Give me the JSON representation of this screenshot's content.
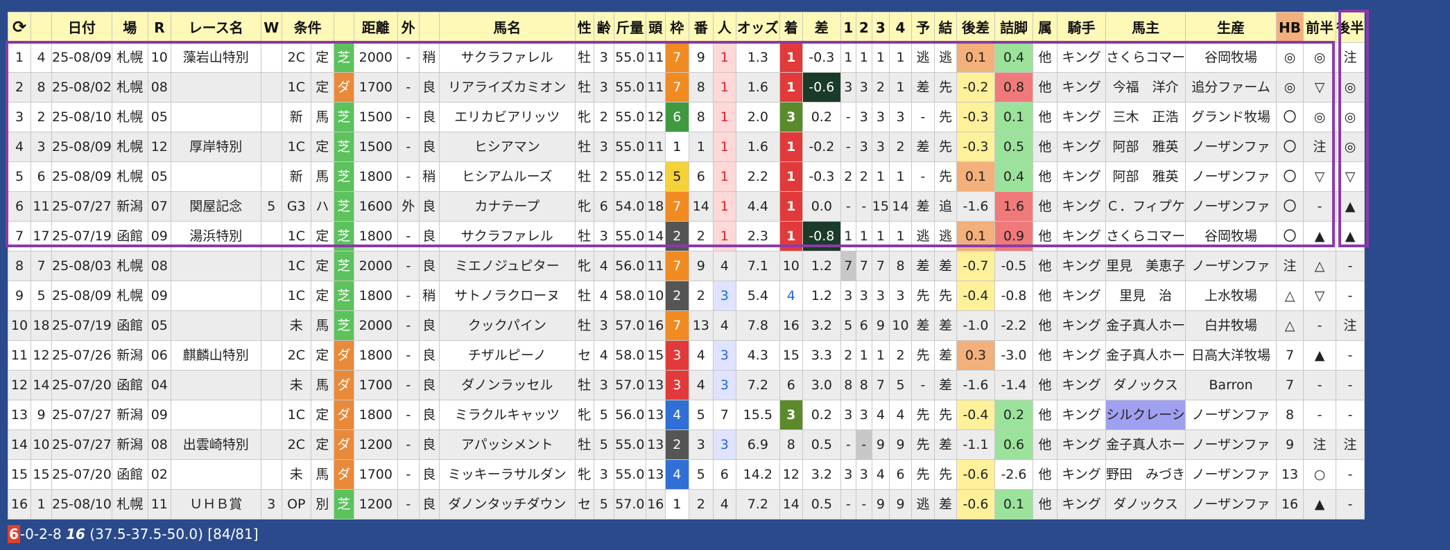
{
  "header": {
    "refresh_icon": "refresh-icon",
    "columns": [
      "日付",
      "場",
      "R",
      "レース名",
      "W",
      "条件",
      "",
      "距離",
      "外",
      "",
      "馬名",
      "性",
      "齢",
      "斤量",
      "頭",
      "枠",
      "番",
      "人",
      "オッズ",
      "着",
      "差",
      "1",
      "2",
      "3",
      "4",
      "予",
      "結",
      "後差",
      "詰脚",
      "属",
      "騎手",
      "馬主",
      "生産",
      "HB",
      "前半",
      "後半"
    ]
  },
  "rows": [
    {
      "no": "1",
      "a": "4",
      "date": "25-08/09",
      "place": "札幌",
      "r": "10",
      "race": "藻岩山特別",
      "w": "",
      "cls": "2C",
      "cond": "定",
      "surf": "芝",
      "dist": "2000",
      "out": "-",
      "track": "稍",
      "horse": "サクラファレル",
      "sex": "牡",
      "age": "3",
      "kin": "55.0",
      "heads": "11",
      "waku": "7",
      "ban": "9",
      "pop": "1",
      "odds": "1.3",
      "fin": "1",
      "diff": "-0.3",
      "c1": "1",
      "c2": "1",
      "c3": "1",
      "c4": "1",
      "pred": "逃",
      "res": "逃",
      "atosa": "0.1",
      "tsume": "0.4",
      "zoku": "他",
      "jockey": "キング",
      "owner": "さくらコマー",
      "breeder": "谷岡牧場",
      "hb": "◎",
      "zen": "◎",
      "kou": "注"
    },
    {
      "no": "2",
      "a": "8",
      "date": "25-08/02",
      "place": "札幌",
      "r": "08",
      "race": "",
      "w": "",
      "cls": "1C",
      "cond": "定",
      "surf": "ダ",
      "dist": "1700",
      "out": "-",
      "track": "良",
      "horse": "リアライズカミオン",
      "sex": "牡",
      "age": "3",
      "kin": "55.0",
      "heads": "11",
      "waku": "7",
      "ban": "8",
      "pop": "1",
      "odds": "1.6",
      "fin": "1",
      "diff": "-0.6",
      "c1": "3",
      "c2": "3",
      "c3": "2",
      "c4": "1",
      "pred": "差",
      "res": "先",
      "atosa": "-0.2",
      "tsume": "0.8",
      "zoku": "他",
      "jockey": "キング",
      "owner": "今福　洋介",
      "breeder": "追分ファーム",
      "hb": "◎",
      "zen": "▽",
      "kou": "◎"
    },
    {
      "no": "3",
      "a": "2",
      "date": "25-08/10",
      "place": "札幌",
      "r": "05",
      "race": "",
      "w": "",
      "cls": "新",
      "cond": "馬",
      "surf": "芝",
      "dist": "1500",
      "out": "-",
      "track": "良",
      "horse": "エリカビアリッツ",
      "sex": "牝",
      "age": "2",
      "kin": "55.0",
      "heads": "12",
      "waku": "6",
      "ban": "8",
      "pop": "1",
      "odds": "2.0",
      "fin": "3",
      "diff": "0.2",
      "c1": "-",
      "c2": "3",
      "c3": "3",
      "c4": "3",
      "pred": "-",
      "res": "先",
      "atosa": "-0.3",
      "tsume": "0.1",
      "zoku": "他",
      "jockey": "キング",
      "owner": "三木　正浩",
      "breeder": "グランド牧場",
      "hb": "〇",
      "zen": "◎",
      "kou": "◎"
    },
    {
      "no": "4",
      "a": "3",
      "date": "25-08/09",
      "place": "札幌",
      "r": "12",
      "race": "厚岸特別",
      "w": "",
      "cls": "1C",
      "cond": "定",
      "surf": "芝",
      "dist": "1500",
      "out": "-",
      "track": "良",
      "horse": "ヒシアマン",
      "sex": "牡",
      "age": "3",
      "kin": "55.0",
      "heads": "11",
      "waku": "1",
      "ban": "1",
      "pop": "1",
      "odds": "1.6",
      "fin": "1",
      "diff": "-0.2",
      "c1": "-",
      "c2": "3",
      "c3": "3",
      "c4": "2",
      "pred": "差",
      "res": "先",
      "atosa": "-0.3",
      "tsume": "0.5",
      "zoku": "他",
      "jockey": "キング",
      "owner": "阿部　雅英",
      "breeder": "ノーザンファ",
      "hb": "〇",
      "zen": "注",
      "kou": "◎"
    },
    {
      "no": "5",
      "a": "6",
      "date": "25-08/09",
      "place": "札幌",
      "r": "05",
      "race": "",
      "w": "",
      "cls": "新",
      "cond": "馬",
      "surf": "芝",
      "dist": "1800",
      "out": "-",
      "track": "稍",
      "horse": "ヒシアムルーズ",
      "sex": "牡",
      "age": "2",
      "kin": "55.0",
      "heads": "12",
      "waku": "5",
      "ban": "6",
      "pop": "1",
      "odds": "2.2",
      "fin": "1",
      "diff": "-0.3",
      "c1": "2",
      "c2": "2",
      "c3": "1",
      "c4": "1",
      "pred": "-",
      "res": "先",
      "atosa": "0.1",
      "tsume": "0.4",
      "zoku": "他",
      "jockey": "キング",
      "owner": "阿部　雅英",
      "breeder": "ノーザンファ",
      "hb": "〇",
      "zen": "▽",
      "kou": "▽"
    },
    {
      "no": "6",
      "a": "11",
      "date": "25-07/27",
      "place": "新潟",
      "r": "07",
      "race": "関屋記念",
      "w": "5",
      "cls": "G3",
      "cond": "ハ",
      "surf": "芝",
      "dist": "1600",
      "out": "外",
      "track": "良",
      "horse": "カナテープ",
      "sex": "牝",
      "age": "6",
      "kin": "54.0",
      "heads": "18",
      "waku": "7",
      "ban": "14",
      "pop": "1",
      "odds": "4.4",
      "fin": "1",
      "diff": "0.0",
      "c1": "-",
      "c2": "-",
      "c3": "15",
      "c4": "14",
      "pred": "差",
      "res": "追",
      "atosa": "-1.6",
      "tsume": "1.6",
      "zoku": "他",
      "jockey": "キング",
      "owner": "Ｃ．フィプケ",
      "breeder": "ノーザンファ",
      "hb": "〇",
      "zen": "-",
      "kou": "▲"
    },
    {
      "no": "7",
      "a": "17",
      "date": "25-07/19",
      "place": "函館",
      "r": "09",
      "race": "湯浜特別",
      "w": "",
      "cls": "1C",
      "cond": "定",
      "surf": "芝",
      "dist": "1800",
      "out": "-",
      "track": "良",
      "horse": "サクラファレル",
      "sex": "牡",
      "age": "3",
      "kin": "55.0",
      "heads": "14",
      "waku": "2",
      "ban": "2",
      "pop": "1",
      "odds": "2.3",
      "fin": "1",
      "diff": "-0.8",
      "c1": "1",
      "c2": "1",
      "c3": "1",
      "c4": "1",
      "pred": "逃",
      "res": "逃",
      "atosa": "0.1",
      "tsume": "0.9",
      "zoku": "他",
      "jockey": "キング",
      "owner": "さくらコマー",
      "breeder": "谷岡牧場",
      "hb": "〇",
      "zen": "▲",
      "kou": "▲"
    },
    {
      "no": "8",
      "a": "7",
      "date": "25-08/03",
      "place": "札幌",
      "r": "08",
      "race": "",
      "w": "",
      "cls": "1C",
      "cond": "定",
      "surf": "芝",
      "dist": "2000",
      "out": "-",
      "track": "良",
      "horse": "ミエノジュピター",
      "sex": "牝",
      "age": "4",
      "kin": "56.0",
      "heads": "11",
      "waku": "7",
      "ban": "9",
      "pop": "4",
      "odds": "7.1",
      "fin": "10",
      "diff": "1.2",
      "c1": "7",
      "c2": "7",
      "c3": "7",
      "c4": "8",
      "pred": "差",
      "res": "差",
      "atosa": "-0.7",
      "tsume": "-0.5",
      "zoku": "他",
      "jockey": "キング",
      "owner": "里見　美恵子",
      "breeder": "ノーザンファ",
      "hb": "注",
      "zen": "△",
      "kou": "-"
    },
    {
      "no": "9",
      "a": "5",
      "date": "25-08/09",
      "place": "札幌",
      "r": "09",
      "race": "",
      "w": "",
      "cls": "1C",
      "cond": "定",
      "surf": "芝",
      "dist": "1800",
      "out": "-",
      "track": "稍",
      "horse": "サトノラクローヌ",
      "sex": "牡",
      "age": "4",
      "kin": "58.0",
      "heads": "10",
      "waku": "2",
      "ban": "2",
      "pop": "3",
      "odds": "5.4",
      "fin": "4",
      "diff": "1.2",
      "c1": "3",
      "c2": "3",
      "c3": "3",
      "c4": "3",
      "pred": "先",
      "res": "先",
      "atosa": "-0.4",
      "tsume": "-0.8",
      "zoku": "他",
      "jockey": "キング",
      "owner": "里見　治",
      "breeder": "上水牧場",
      "hb": "△",
      "zen": "▽",
      "kou": "-"
    },
    {
      "no": "10",
      "a": "18",
      "date": "25-07/19",
      "place": "函館",
      "r": "05",
      "race": "",
      "w": "",
      "cls": "未",
      "cond": "馬",
      "surf": "芝",
      "dist": "2000",
      "out": "-",
      "track": "良",
      "horse": "クックパイン",
      "sex": "牡",
      "age": "3",
      "kin": "57.0",
      "heads": "16",
      "waku": "7",
      "ban": "13",
      "pop": "4",
      "odds": "7.8",
      "fin": "16",
      "diff": "3.2",
      "c1": "5",
      "c2": "6",
      "c3": "9",
      "c4": "10",
      "pred": "差",
      "res": "差",
      "atosa": "-1.0",
      "tsume": "-2.2",
      "zoku": "他",
      "jockey": "キング",
      "owner": "金子真人ホー",
      "breeder": "白井牧場",
      "hb": "△",
      "zen": "-",
      "kou": "注"
    },
    {
      "no": "11",
      "a": "12",
      "date": "25-07/26",
      "place": "新潟",
      "r": "06",
      "race": "麒麟山特別",
      "w": "",
      "cls": "2C",
      "cond": "定",
      "surf": "ダ",
      "dist": "1800",
      "out": "-",
      "track": "良",
      "horse": "チザルピーノ",
      "sex": "セ",
      "age": "4",
      "kin": "58.0",
      "heads": "15",
      "waku": "3",
      "ban": "4",
      "pop": "3",
      "odds": "4.3",
      "fin": "15",
      "diff": "3.3",
      "c1": "2",
      "c2": "1",
      "c3": "1",
      "c4": "2",
      "pred": "先",
      "res": "差",
      "atosa": "0.3",
      "tsume": "-3.0",
      "zoku": "他",
      "jockey": "キング",
      "owner": "金子真人ホー",
      "breeder": "日高大洋牧場",
      "hb": "7",
      "zen": "▲",
      "kou": "-"
    },
    {
      "no": "12",
      "a": "14",
      "date": "25-07/20",
      "place": "函館",
      "r": "04",
      "race": "",
      "w": "",
      "cls": "未",
      "cond": "馬",
      "surf": "ダ",
      "dist": "1700",
      "out": "-",
      "track": "良",
      "horse": "ダノンラッセル",
      "sex": "牡",
      "age": "3",
      "kin": "57.0",
      "heads": "13",
      "waku": "3",
      "ban": "4",
      "pop": "3",
      "odds": "7.2",
      "fin": "6",
      "diff": "3.0",
      "c1": "8",
      "c2": "8",
      "c3": "7",
      "c4": "5",
      "pred": "-",
      "res": "差",
      "atosa": "-1.6",
      "tsume": "-1.4",
      "zoku": "他",
      "jockey": "キング",
      "owner": "ダノックス",
      "breeder": "Barron",
      "hb": "7",
      "zen": "-",
      "kou": "-"
    },
    {
      "no": "13",
      "a": "9",
      "date": "25-07/27",
      "place": "新潟",
      "r": "09",
      "race": "",
      "w": "",
      "cls": "1C",
      "cond": "定",
      "surf": "ダ",
      "dist": "1800",
      "out": "-",
      "track": "良",
      "horse": "ミラクルキャッツ",
      "sex": "牝",
      "age": "5",
      "kin": "56.0",
      "heads": "13",
      "waku": "4",
      "ban": "5",
      "pop": "7",
      "odds": "15.5",
      "fin": "3",
      "diff": "0.2",
      "c1": "3",
      "c2": "3",
      "c3": "4",
      "c4": "4",
      "pred": "先",
      "res": "先",
      "atosa": "-0.4",
      "tsume": "0.2",
      "zoku": "他",
      "jockey": "キング",
      "owner": "シルクレーシ",
      "breeder": "ノーザンファ",
      "hb": "8",
      "zen": "-",
      "kou": "-"
    },
    {
      "no": "14",
      "a": "10",
      "date": "25-07/27",
      "place": "新潟",
      "r": "08",
      "race": "出雲崎特別",
      "w": "",
      "cls": "2C",
      "cond": "定",
      "surf": "ダ",
      "dist": "1200",
      "out": "-",
      "track": "良",
      "horse": "アパッシメント",
      "sex": "牡",
      "age": "5",
      "kin": "55.0",
      "heads": "13",
      "waku": "2",
      "ban": "3",
      "pop": "3",
      "odds": "6.9",
      "fin": "8",
      "diff": "0.5",
      "c1": "-",
      "c2": "-",
      "c3": "9",
      "c4": "9",
      "pred": "先",
      "res": "差",
      "atosa": "-1.1",
      "tsume": "0.6",
      "zoku": "他",
      "jockey": "キング",
      "owner": "金子真人ホー",
      "breeder": "ノーザンファ",
      "hb": "9",
      "zen": "注",
      "kou": "注"
    },
    {
      "no": "15",
      "a": "15",
      "date": "25-07/20",
      "place": "函館",
      "r": "02",
      "race": "",
      "w": "",
      "cls": "未",
      "cond": "馬",
      "surf": "ダ",
      "dist": "1700",
      "out": "-",
      "track": "良",
      "horse": "ミッキーラサルダン",
      "sex": "牝",
      "age": "3",
      "kin": "55.0",
      "heads": "13",
      "waku": "4",
      "ban": "5",
      "pop": "6",
      "odds": "14.2",
      "fin": "12",
      "diff": "3.2",
      "c1": "3",
      "c2": "3",
      "c3": "4",
      "c4": "6",
      "pred": "先",
      "res": "先",
      "atosa": "-0.6",
      "tsume": "-2.6",
      "zoku": "他",
      "jockey": "キング",
      "owner": "野田　みづき",
      "breeder": "ノーザンファ",
      "hb": "13",
      "zen": "○",
      "kou": "-"
    },
    {
      "no": "16",
      "a": "1",
      "date": "25-08/10",
      "place": "札幌",
      "r": "11",
      "race": "ＵＨＢ賞",
      "w": "3",
      "cls": "OP",
      "cond": "別",
      "surf": "芝",
      "dist": "1200",
      "out": "-",
      "track": "良",
      "horse": "ダノンタッチダウン",
      "sex": "セ",
      "age": "5",
      "kin": "57.0",
      "heads": "16",
      "waku": "1",
      "ban": "2",
      "pop": "4",
      "odds": "7.2",
      "fin": "14",
      "diff": "0.5",
      "c1": "-",
      "c2": "-",
      "c3": "9",
      "c4": "9",
      "pred": "逃",
      "res": "差",
      "atosa": "-0.6",
      "tsume": "0.1",
      "zoku": "他",
      "jockey": "キング",
      "owner": "ダノックス",
      "breeder": "ノーザンファ",
      "hb": "16",
      "zen": "▲",
      "kou": "-"
    }
  ],
  "footer": {
    "wins": "6",
    "rest": "-0-2-8 ",
    "count": "16",
    "stats": " (37.5-37.5-50.0) [84/81]"
  }
}
